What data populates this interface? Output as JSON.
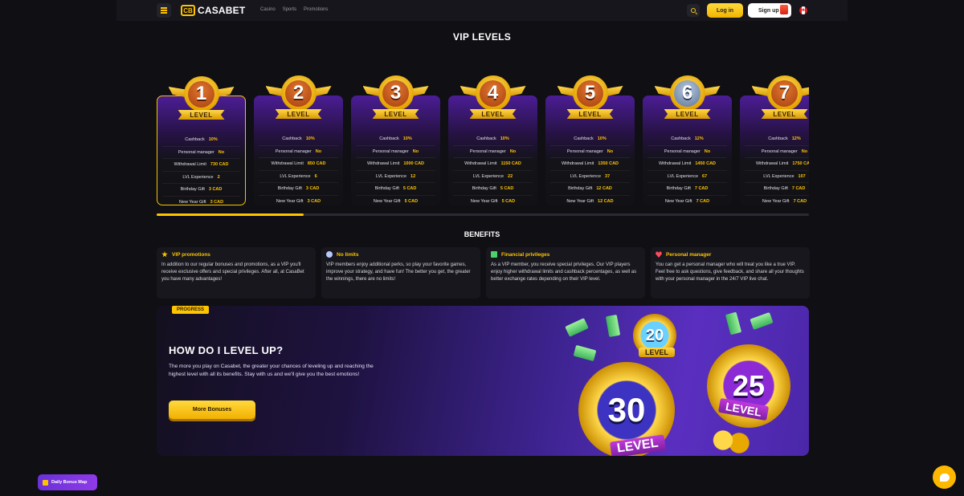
{
  "header": {
    "logo_mark": "CB",
    "logo_text": "CASABET",
    "nav": [
      "Casino",
      "Sports",
      "Promotions"
    ],
    "login_label": "Log in",
    "signup_label": "Sign up"
  },
  "vip_title": "VIP LEVELS",
  "levels": [
    {
      "number": "1",
      "label": "LEVEL",
      "rows": [
        [
          "Cashback",
          "10%"
        ],
        [
          "Personal manager",
          "No"
        ],
        [
          "Withdrawal Limit",
          "730 CAD"
        ],
        [
          "LVL Experience",
          "2"
        ],
        [
          "Birthday Gift",
          "3 CAD"
        ],
        [
          "New Year Gift",
          "3 CAD"
        ]
      ]
    },
    {
      "number": "2",
      "label": "LEVEL",
      "rows": [
        [
          "Cashback",
          "10%"
        ],
        [
          "Personal manager",
          "No"
        ],
        [
          "Withdrawal Limit",
          "850 CAD"
        ],
        [
          "LVL Experience",
          "6"
        ],
        [
          "Birthday Gift",
          "3 CAD"
        ],
        [
          "New Year Gift",
          "3 CAD"
        ]
      ]
    },
    {
      "number": "3",
      "label": "LEVEL",
      "rows": [
        [
          "Cashback",
          "10%"
        ],
        [
          "Personal manager",
          "No"
        ],
        [
          "Withdrawal Limit",
          "1000 CAD"
        ],
        [
          "LVL Experience",
          "12"
        ],
        [
          "Birthday Gift",
          "5 CAD"
        ],
        [
          "New Year Gift",
          "5 CAD"
        ]
      ]
    },
    {
      "number": "4",
      "label": "LEVEL",
      "rows": [
        [
          "Cashback",
          "10%"
        ],
        [
          "Personal manager",
          "No"
        ],
        [
          "Withdrawal Limit",
          "1150 CAD"
        ],
        [
          "LVL Experience",
          "22"
        ],
        [
          "Birthday Gift",
          "5 CAD"
        ],
        [
          "New Year Gift",
          "5 CAD"
        ]
      ]
    },
    {
      "number": "5",
      "label": "LEVEL",
      "rows": [
        [
          "Cashback",
          "10%"
        ],
        [
          "Personal manager",
          "No"
        ],
        [
          "Withdrawal Limit",
          "1350 CAD"
        ],
        [
          "LVL Experience",
          "37"
        ],
        [
          "Birthday Gift",
          "12 CAD"
        ],
        [
          "New Year Gift",
          "12 CAD"
        ]
      ]
    },
    {
      "number": "6",
      "label": "LEVEL",
      "rows": [
        [
          "Cashback",
          "12%"
        ],
        [
          "Personal manager",
          "No"
        ],
        [
          "Withdrawal Limit",
          "1450 CAD"
        ],
        [
          "LVL Experience",
          "67"
        ],
        [
          "Birthday Gift",
          "7 CAD"
        ],
        [
          "New Year Gift",
          "7 CAD"
        ]
      ]
    },
    {
      "number": "7",
      "label": "LEVEL",
      "rows": [
        [
          "Cashback",
          "12%"
        ],
        [
          "Personal manager",
          "No"
        ],
        [
          "Withdrawal Limit",
          "1750 CAD"
        ],
        [
          "LVL Experience",
          "107"
        ],
        [
          "Birthday Gift",
          "7 CAD"
        ],
        [
          "New Year Gift",
          "7 CAD"
        ]
      ]
    }
  ],
  "slider_progress": 0.225,
  "benefits_title": "BENEFITS",
  "benefits": [
    {
      "icon": "star-icon",
      "title": "VIP promotions",
      "text": "In addition to our regular bonuses and promotions, as a VIP you'll receive exclusive offers and special privileges. After all, at CasaBet you have many advantages!"
    },
    {
      "icon": "lightbulb-icon",
      "title": "No limits",
      "text": "VIP members enjoy additional perks, so play your favorite games, improve your strategy, and have fun! The better you get, the greater the winnings, there are no limits!"
    },
    {
      "icon": "money-icon",
      "title": "Financial privileges",
      "text": "As a VIP member, you receive special privileges. Our VIP players enjoy higher withdrawal limits and cashback percentages, as well as better exchange rates depending on their VIP level."
    },
    {
      "icon": "heart-icon",
      "title": "Personal manager",
      "text": "You can get a personal manager who will treat you like a true VIP. Feel free to ask questions, give feedback, and share all your thoughts with your personal manager in the 24/7 VIP live chat."
    }
  ],
  "promo": {
    "tag": "PROGRESS",
    "title": "HOW DO I LEVEL UP?",
    "text": "The more you play on Casabet, the greater your chances of leveling up and reaching the highest level with all its benefits. Stay with us and we'll give you the best emotions!",
    "button": "More Bonuses",
    "badges": [
      {
        "number": "20",
        "label": "LEVEL"
      },
      {
        "number": "25",
        "label": "LEVEL"
      },
      {
        "number": "30",
        "label": "LEVEL"
      }
    ]
  },
  "daily_bonus_label": "Daily Bonus Map",
  "colors": {
    "accent": "#ffc400",
    "purple": "#4b1d95",
    "background": "#0f0f14"
  }
}
